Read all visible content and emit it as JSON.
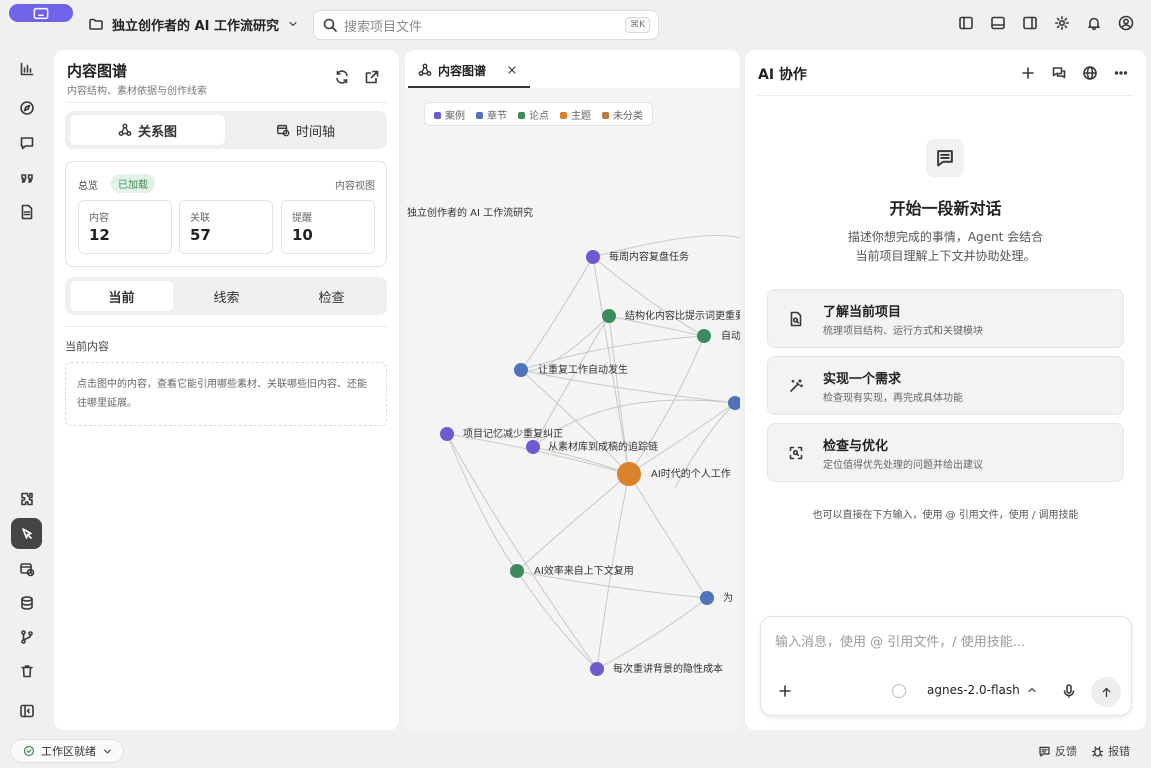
{
  "header": {
    "project_name": "独立创作者的 AI 工作流研究",
    "search_placeholder": "搜索项目文件",
    "search_shortcut": "⌘K"
  },
  "left_panel": {
    "title": "内容图谱",
    "subtitle": "内容结构、素材依据与创作线索",
    "view_tabs": [
      {
        "label": "关系图",
        "icon": "graph-icon",
        "active": true
      },
      {
        "label": "时间轴",
        "icon": "calendar-clock-icon",
        "active": false
      }
    ],
    "overview": {
      "label": "总览",
      "badge": "已加载",
      "view_link": "内容视图",
      "stats": [
        {
          "label": "内容",
          "value": "12"
        },
        {
          "label": "关联",
          "value": "57"
        },
        {
          "label": "提醒",
          "value": "10"
        }
      ]
    },
    "sub_tabs": [
      {
        "label": "当前",
        "active": true
      },
      {
        "label": "线索",
        "active": false
      },
      {
        "label": "检查",
        "active": false
      }
    ],
    "current_content_label": "当前内容",
    "empty_hint": "点击图中的内容，查看它能引用哪些素材、关联哪些旧内容、还能往哪里延展。"
  },
  "graph_tab": {
    "label": "内容图谱",
    "legend": [
      {
        "label": "案例",
        "color": "#6d5bd0"
      },
      {
        "label": "章节",
        "color": "#4f72b8"
      },
      {
        "label": "论点",
        "color": "#3e8a5c"
      },
      {
        "label": "主题",
        "color": "#d9822b"
      },
      {
        "label": "未分类",
        "color": "#c07a3f"
      }
    ],
    "nodes": [
      {
        "label": "独立创作者的 AI 工作流研究"
      },
      {
        "label": "每周内容复盘任务"
      },
      {
        "label": "结构化内容比提示词更重要"
      },
      {
        "label": "自动"
      },
      {
        "label": "让重复工作自动发生"
      },
      {
        "label": "项目记忆减少重复纠正"
      },
      {
        "label": "从素材库到成稿的追踪链"
      },
      {
        "label": "AI时代的个人工作"
      },
      {
        "label": "AI效率来自上下文复用"
      },
      {
        "label": "为"
      },
      {
        "label": "每次重讲背景的隐性成本"
      }
    ]
  },
  "right_panel": {
    "title": "AI 协作",
    "empty_title": "开始一段新对话",
    "empty_desc_1": "描述你想完成的事情，Agent 会结合",
    "empty_desc_2": "当前项目理解上下文并协助处理。",
    "suggestions": [
      {
        "title": "了解当前项目",
        "desc": "梳理项目结构、运行方式和关键模块",
        "icon": "file-search-icon"
      },
      {
        "title": "实现一个需求",
        "desc": "检查现有实现，再完成具体功能",
        "icon": "magic-wand-icon"
      },
      {
        "title": "检查与优化",
        "desc": "定位值得优先处理的问题并给出建议",
        "icon": "scan-icon"
      }
    ],
    "footer_hint": "也可以直接在下方输入，使用 @ 引用文件，使用 / 调用技能",
    "composer": {
      "placeholder": "输入消息，使用 @ 引用文件，/ 使用技能...",
      "model": "agnes-2.0-flash"
    }
  },
  "status_bar": {
    "status": "工作区就绪",
    "feedback": "反馈",
    "report_bug": "报错"
  }
}
